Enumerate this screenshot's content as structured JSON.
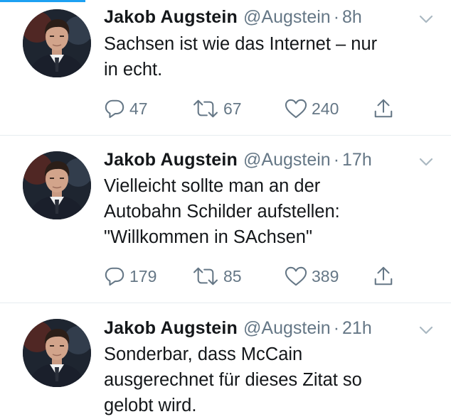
{
  "colors": {
    "accent": "#1da1f2",
    "text": "#14171a",
    "secondary": "#657786",
    "divider": "#e6ecf0"
  },
  "tweets": [
    {
      "name": "Jakob Augstein",
      "handle": "@Augstein",
      "separator": "·",
      "time": "8h",
      "text_lines": [
        "Sachsen ist wie das Internet – nur",
        "in echt."
      ],
      "replies": "47",
      "retweets": "67",
      "likes": "240",
      "icons": [
        "reply-icon",
        "retweet-icon",
        "like-icon",
        "share-icon",
        "chevron-down-icon"
      ]
    },
    {
      "name": "Jakob Augstein",
      "handle": "@Augstein",
      "separator": "·",
      "time": "17h",
      "text_lines": [
        "Vielleicht sollte man an der",
        "Autobahn Schilder aufstellen:",
        "\"Willkommen in SAchsen\""
      ],
      "replies": "179",
      "retweets": "85",
      "likes": "389",
      "icons": [
        "reply-icon",
        "retweet-icon",
        "like-icon",
        "share-icon",
        "chevron-down-icon"
      ]
    },
    {
      "name": "Jakob Augstein",
      "handle": "@Augstein",
      "separator": "·",
      "time": "21h",
      "text_lines": [
        "Sonderbar, dass McCain",
        "ausgerechnet für dieses Zitat so",
        "gelobt wird."
      ],
      "icons": [
        "chevron-down-icon"
      ]
    }
  ]
}
